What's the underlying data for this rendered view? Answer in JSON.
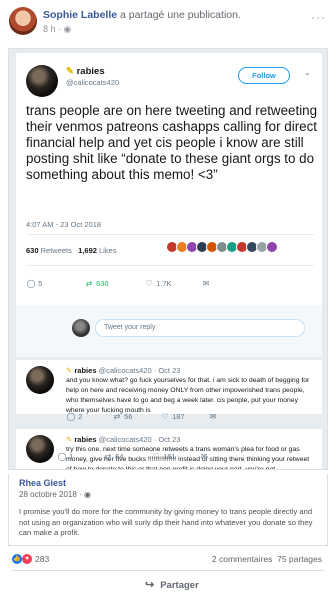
{
  "header": {
    "name": "Sophie Labelle",
    "action": " a partagé une publication.",
    "time": "8 h"
  },
  "tweet": {
    "display_name": "rabies",
    "handle": "@calicocats420",
    "follow_label": "Follow",
    "text": "trans people are on here tweeting and retweeting their venmos patreons cashapps calling for direct financial help and yet cis people i know are still posting shit like “donate to these giant orgs to do something about this memo! <3”",
    "date": "4:07 AM - 23 Oct 2018",
    "retweets_count": "630",
    "retweets_label": "Retweets",
    "likes_count": "1,692",
    "likes_label": "Likes",
    "actions": {
      "replies": "5",
      "retweets": "630",
      "likes": "1.7K"
    },
    "reply_placeholder": "Tweet your reply",
    "face_colors": [
      "#c0392b",
      "#e67e22",
      "#8e44ad",
      "#2c3e50",
      "#d35400",
      "#7f8c8d",
      "#16a085",
      "#c0392b",
      "#34495e",
      "#95a5a6",
      "#8e44ad"
    ]
  },
  "replies": [
    {
      "name": "rabies",
      "handle": "@calicocats420 · Oct 23",
      "text": "and you know what? go fuck yourselves for that. i am sick to death of begging for help on here and receiving money ONLY from other impoverished trans people, who themselves have to go and beg a week later. cis people, put your money where your fucking mouth is",
      "actions": {
        "replies": "2",
        "retweets": "56",
        "likes": "187"
      }
    },
    {
      "name": "rabies",
      "handle": "@calicocats420 · Oct 23",
      "text": "try this one. next time someone retweets a trans woman's plea for food or gas money, give her five bucks !!!!!!!!!!!!!!! instead of sitting there thinking your retweet of how to donate to this or that non profit is doing your part. you're not.",
      "actions": {
        "replies": "1",
        "retweets": "64",
        "likes": "161"
      }
    }
  ],
  "comment": {
    "name": "Rhea Giest",
    "date": "28 octobre 2018 · ",
    "text": "I promise you'll do more for the community by giving money to trans people directly and not using an organization who will surly dip their hand into whatever you donate so they can make a profit."
  },
  "reactions": {
    "count": "283",
    "comments": "2 commentaires",
    "shares": "75 partages",
    "like_color": "#1877f2",
    "love_color": "#f33e58"
  },
  "share_label": "Partager"
}
